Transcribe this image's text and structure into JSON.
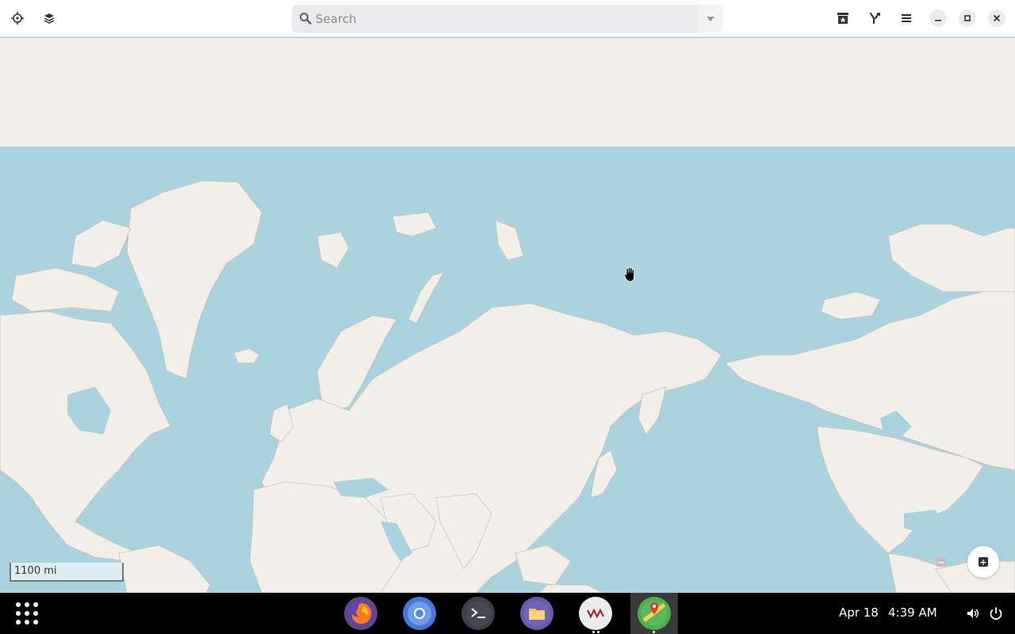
{
  "header": {
    "locate_icon": "crosshair-icon",
    "layers_icon": "layers-icon",
    "search": {
      "placeholder": "Search",
      "value": ""
    },
    "favorites_icon": "bookmark-star-icon",
    "route_icon": "route-icon",
    "menu_icon": "hamburger-icon",
    "window_controls": [
      "minimize-icon",
      "maximize-icon",
      "close-icon"
    ]
  },
  "map": {
    "scale_label": "1100 mi",
    "zoom_out_icon": "minus-icon",
    "zoom_in_icon": "plus-icon",
    "water_color": "#aad3df",
    "land_color": "#f2efe9"
  },
  "taskbar": {
    "apps_icon": "app-grid-icon",
    "dock": [
      "firefox-icon",
      "chromium-icon",
      "terminal-icon",
      "files-icon",
      "vm-icon",
      "maps-icon"
    ],
    "date": "Apr 18",
    "time": "4:39 AM",
    "volume_icon": "volume-icon",
    "power_icon": "power-icon"
  }
}
